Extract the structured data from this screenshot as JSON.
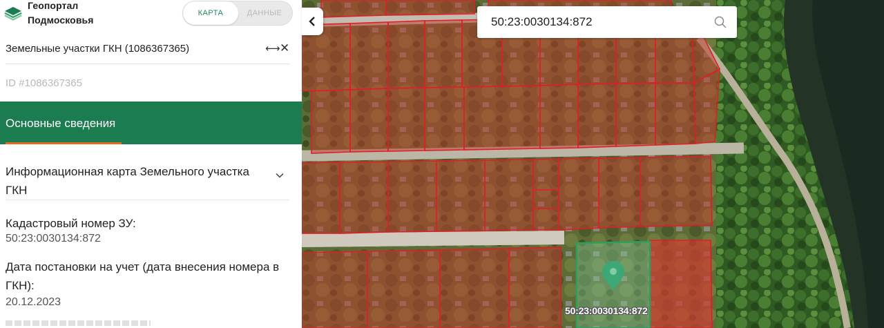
{
  "app": {
    "logo_line1": "Геопортал",
    "logo_line2": "Подмосковья",
    "brand_color": "#1b7d4f",
    "accent_color": "#e76a1e"
  },
  "view_toggle": {
    "map_label": "КАРТА",
    "data_label": "ДАННЫЕ",
    "selected": "КАРТА"
  },
  "panel": {
    "layer_title": "Земельные участки ГКН (1086367365)",
    "expand_icon": "expand-arrows-icon",
    "close_icon": "close-icon",
    "object_id": "ID #1086367365",
    "active_tab": "Основные сведения",
    "accordion_title": "Информационная карта Земельного участка ГКН",
    "fields": [
      {
        "label": "Кадастровый номер ЗУ:",
        "value": "50:23:0030134:872"
      },
      {
        "label": "Дата постановки на учет (дата внесения номера в ГКН):",
        "value": "20.12.2023"
      }
    ]
  },
  "map": {
    "search_value": "50:23:0030134:872",
    "search_icon": "search-icon",
    "collapse_icon": "chevron-left-icon",
    "selected_parcel_label": "50:23:0030134:872",
    "parcel_stroke_color": "#e01e28",
    "parcel_fill_color": "#c0392b",
    "selected_parcel_color": "#2e9e5e",
    "marker_icon": "location-pin-icon"
  }
}
